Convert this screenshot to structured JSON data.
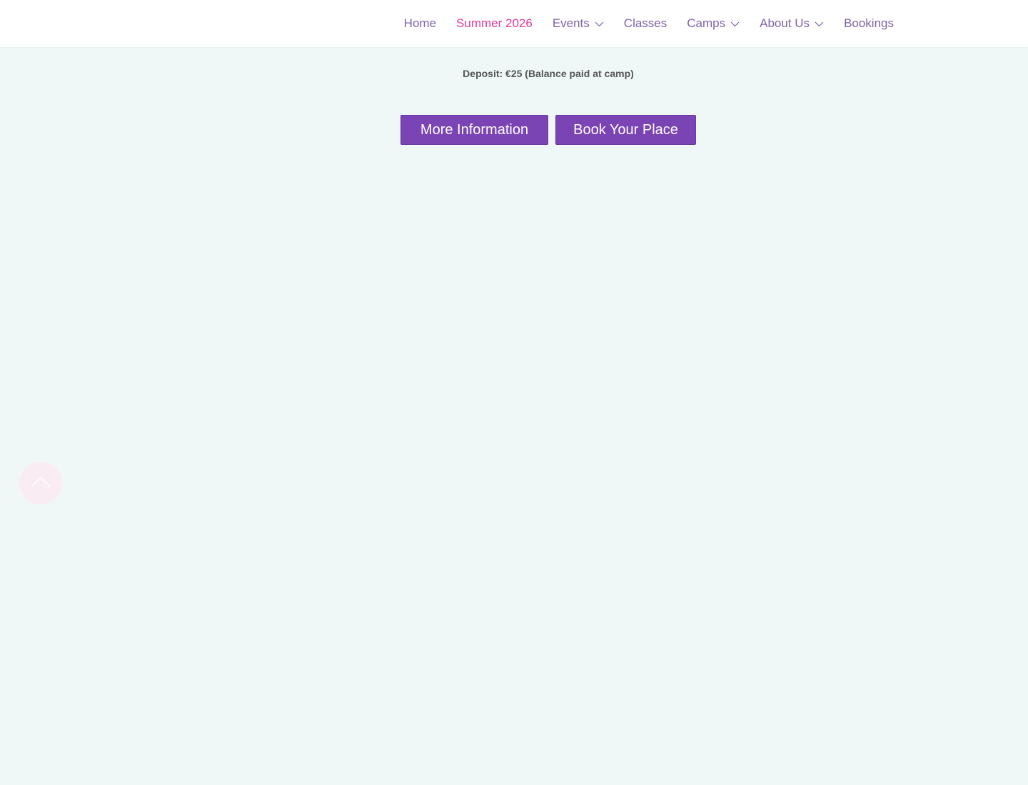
{
  "nav": {
    "items": [
      {
        "label": "Home",
        "dropdown": false,
        "active": false
      },
      {
        "label": "Summer 2026",
        "dropdown": false,
        "active": true
      },
      {
        "label": "Events",
        "dropdown": true,
        "active": false
      },
      {
        "label": "Classes",
        "dropdown": false,
        "active": false
      },
      {
        "label": "Camps",
        "dropdown": true,
        "active": false
      },
      {
        "label": "About Us",
        "dropdown": true,
        "active": false
      },
      {
        "label": "Bookings",
        "dropdown": false,
        "active": false
      }
    ]
  },
  "main": {
    "deposit_text": "Deposit: €25 (Balance paid at camp)",
    "more_info_label": "More Information",
    "book_label": "Book Your Place"
  },
  "icons": {
    "dropdown": "chevron-down-icon",
    "scroll_top": "chevron-up-icon"
  },
  "colors": {
    "nav_text": "#8062a8",
    "nav_active": "#e8399a",
    "button_bg": "#7a44b5",
    "page_bg": "#f0f8f7"
  }
}
